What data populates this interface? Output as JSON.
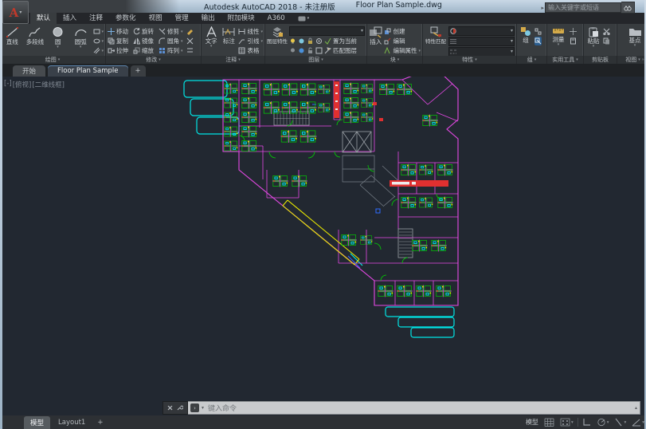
{
  "title_bar": {
    "app_title": "Autodesk AutoCAD 2018 - 未注册版",
    "doc_title": "Floor Plan Sample.dwg",
    "search_placeholder": "输入关键字或短语"
  },
  "quick_access_icons": [
    "new-file",
    "open-file",
    "save",
    "save-as",
    "plot",
    "undo",
    "redo",
    "customize-dropdown"
  ],
  "ribbon": {
    "tabs": [
      {
        "label": "默认",
        "active": true
      },
      {
        "label": "插入",
        "active": false
      },
      {
        "label": "注释",
        "active": false
      },
      {
        "label": "参数化",
        "active": false
      },
      {
        "label": "视图",
        "active": false
      },
      {
        "label": "管理",
        "active": false
      },
      {
        "label": "输出",
        "active": false
      },
      {
        "label": "附加模块",
        "active": false
      },
      {
        "label": "A360",
        "active": false
      }
    ],
    "panels": [
      {
        "name": "绘图",
        "tools": [
          "直线",
          "多段线",
          "圆",
          "圆弧"
        ]
      },
      {
        "name": "修改",
        "tools": [
          "移动",
          "旋转",
          "修剪",
          "复制",
          "镜像",
          "圆角",
          "拉伸",
          "缩放",
          "阵列"
        ]
      },
      {
        "name": "注释",
        "tools": [
          "文字",
          "标注",
          "线性",
          "引线",
          "表格"
        ]
      },
      {
        "name": "图层",
        "tools": [
          "图层特性",
          "置为当前",
          "匹配图层"
        ]
      },
      {
        "name": "块",
        "tools": [
          "插入",
          "创建",
          "编辑",
          "编辑属性"
        ]
      },
      {
        "name": "特性",
        "tools": [
          "特性匹配"
        ]
      },
      {
        "name": "组",
        "tools": [
          "组"
        ]
      },
      {
        "name": "实用工具",
        "tools": [
          "测量"
        ]
      },
      {
        "name": "剪贴板",
        "tools": [
          "粘贴"
        ]
      },
      {
        "name": "视图",
        "tools": [
          "基点"
        ]
      }
    ]
  },
  "file_tabs": {
    "start": "开始",
    "drawing": "Floor Plan Sample",
    "new_tab": "+"
  },
  "viewport": {
    "minus": "[-]",
    "view": "[俯视]",
    "visual_style": "[二维线框]"
  },
  "command_line": {
    "placeholder": "键入命令"
  },
  "layout_tabs": {
    "model": "模型",
    "layout1": "Layout1",
    "new_tab": "+"
  },
  "status_bar": {
    "model_label": "模型",
    "icons": [
      "grid-icon",
      "snap-icon",
      "ortho-icon",
      "polar-tracking-icon",
      "isodraft-icon",
      "osnap-icon"
    ]
  },
  "drawing": {
    "description": "Office building floor plan, L-shaped with diagonal atrium corridor, workstation clusters, stair cores and stepped glass canopies",
    "colors": {
      "wall": "#e649e6",
      "glass": "#00e5e5",
      "furniture": "#00d400",
      "accent": "#e8e800",
      "alert": "#e03030",
      "core": "#9aa0a6",
      "background": "#222831"
    }
  }
}
